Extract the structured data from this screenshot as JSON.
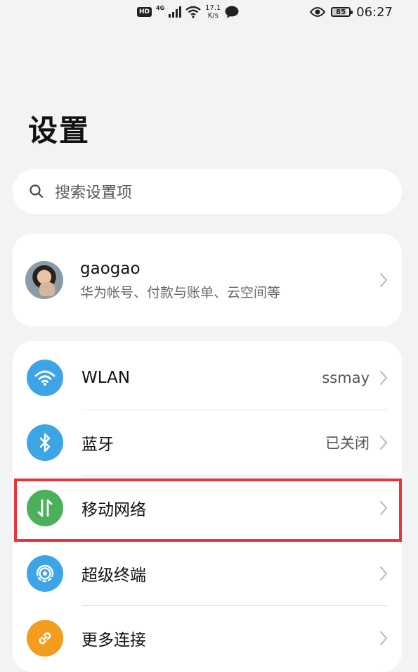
{
  "status_bar": {
    "hd": "HD",
    "network_type": "4G",
    "speed_value": "17.1",
    "speed_unit": "K/s",
    "battery": "85",
    "time": "06:27"
  },
  "page": {
    "title": "设置"
  },
  "search": {
    "placeholder": "搜索设置项"
  },
  "account": {
    "name": "gaogao",
    "subtitle": "华为帐号、付款与账单、云空间等"
  },
  "settings": {
    "items": [
      {
        "label": "WLAN",
        "value": "ssmay",
        "icon": "wifi-icon",
        "color": "#3da5e6"
      },
      {
        "label": "蓝牙",
        "value": "已关闭",
        "icon": "bluetooth-icon",
        "color": "#3da5e6"
      },
      {
        "label": "移动网络",
        "value": "",
        "icon": "mobile-data-icon",
        "color": "#4cb05a"
      },
      {
        "label": "超级终端",
        "value": "",
        "icon": "super-device-icon",
        "color": "#3da5e6"
      },
      {
        "label": "更多连接",
        "value": "",
        "icon": "link-icon",
        "color": "#f39c1e"
      }
    ]
  },
  "colors": {
    "highlight": "#e8353b",
    "background": "#f1f3f5"
  }
}
